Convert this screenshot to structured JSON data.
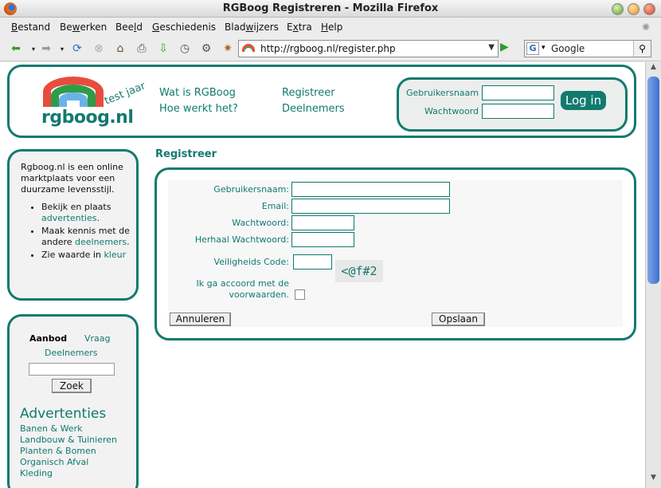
{
  "window": {
    "title": "RGBoog Registreren - Mozilla Firefox"
  },
  "menu": [
    "Bestand",
    "Bewerken",
    "Beeld",
    "Geschiedenis",
    "Bladwijzers",
    "Extra",
    "Help"
  ],
  "menu_underline": [
    "B",
    "w",
    "l",
    "G",
    "w",
    "x",
    "H"
  ],
  "address": {
    "url": "http://rgboog.nl/register.php"
  },
  "search": {
    "engine_icon": "G",
    "value": "Google"
  },
  "site": {
    "logo_text": "rgboog.nl",
    "logo_tag": "test jaar",
    "nav": {
      "wat_is": "Wat is RGBoog",
      "hoe_werkt": "Hoe werkt het?",
      "registreer": "Registreer",
      "deelnemers": "Deelnemers"
    },
    "login": {
      "username_label": "Gebruikersnaam",
      "password_label": "Wachtwoord",
      "button": "Log in"
    }
  },
  "sidebar": {
    "intro": "Rgboog.nl is een online marktplaats voor een duurzame levensstijl.",
    "bullets": [
      {
        "text": "Bekijk en plaats ",
        "link": "advertenties",
        "after": "."
      },
      {
        "text": "Maak kennis met de andere ",
        "link": "deelnemers",
        "after": "."
      },
      {
        "text": "Zie waarde in ",
        "link": "kleur",
        "after": ""
      }
    ],
    "tabs": {
      "aanbod": "Aanbod",
      "vraag": "Vraag",
      "deelnemers": "Deelnemers"
    },
    "search_button": "Zoek",
    "adv_title": "Advertenties",
    "categories": [
      "Banen & Werk",
      "Landbouw & Tuinieren",
      "Planten & Bomen",
      "Organisch Afval",
      "Kleding"
    ]
  },
  "form": {
    "title": "Registreer",
    "username_label": "Gebruikersnaam:",
    "email_label": "Email:",
    "password_label": "Wachtwoord:",
    "password_repeat_label": "Herhaal Wachtwoord:",
    "captcha_label": "Veiligheids Code:",
    "captcha_code": "<@f#2",
    "terms_line1": "Ik ga accoord met de",
    "terms_link": "voorwaarden",
    "terms_after": ".",
    "cancel_button": "Annuleren",
    "save_button": "Opslaan"
  },
  "colors": {
    "accent": "#127a6f",
    "rainbow_red": "#e84d3c",
    "rainbow_green": "#2f9c49",
    "rainbow_blue": "#6ab2e8"
  }
}
